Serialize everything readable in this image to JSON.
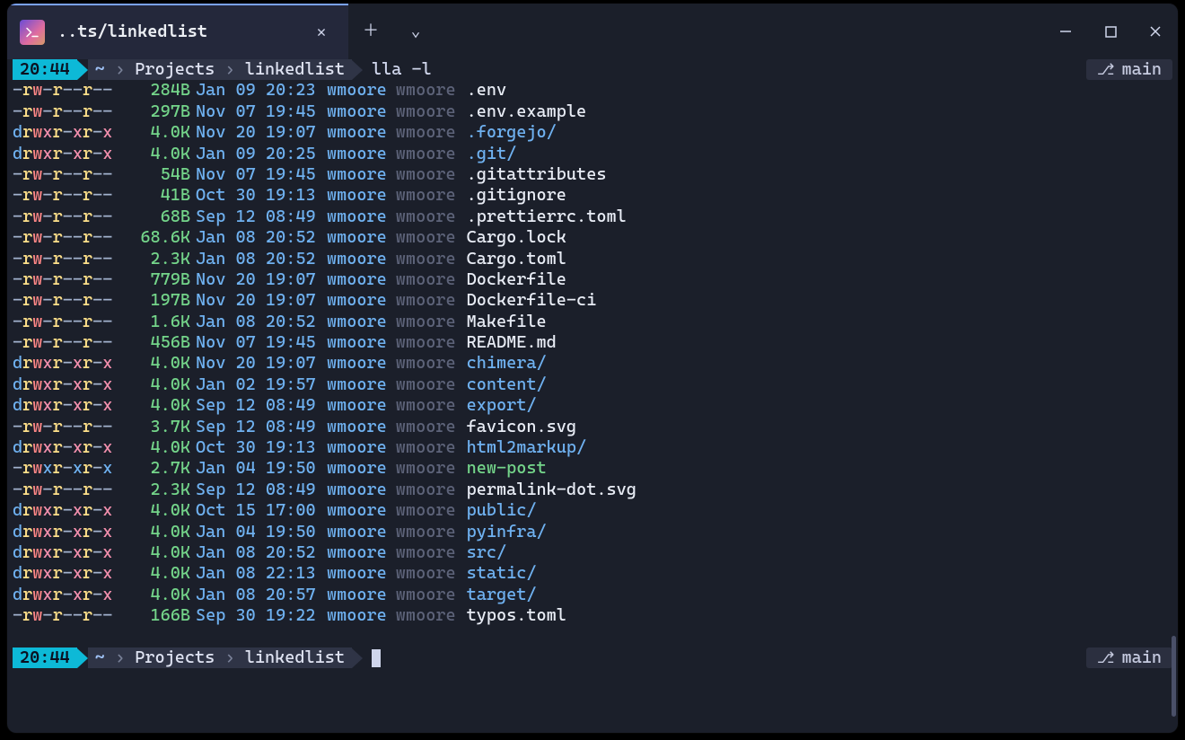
{
  "titlebar": {
    "tab_title": "..ts/linkedlist",
    "close_glyph": "✕",
    "newtab_glyph": "＋",
    "dropdown_glyph": "⌄",
    "min_label": "minimize",
    "max_label": "maximize",
    "close_label": "close"
  },
  "prompt": {
    "time": "20:44",
    "path_segments": [
      "~",
      "Projects",
      "linkedlist"
    ],
    "command": "lla -l",
    "branch": "main"
  },
  "prompt2": {
    "time": "20:44",
    "path_segments": [
      "~",
      "Projects",
      "linkedlist"
    ],
    "branch": "main"
  },
  "files": [
    {
      "perm": "-rw-r--r--",
      "size": "284B",
      "date": "Jan 09 20:23",
      "owner": "wmoore",
      "group": "wmoore",
      "name": ".env",
      "type": "file"
    },
    {
      "perm": "-rw-r--r--",
      "size": "297B",
      "date": "Nov 07 19:45",
      "owner": "wmoore",
      "group": "wmoore",
      "name": ".env.example",
      "type": "file"
    },
    {
      "perm": "drwxr-xr-x",
      "size": "4.0K",
      "date": "Nov 20 19:07",
      "owner": "wmoore",
      "group": "wmoore",
      "name": ".forgejo/",
      "type": "dir"
    },
    {
      "perm": "drwxr-xr-x",
      "size": "4.0K",
      "date": "Jan 09 20:25",
      "owner": "wmoore",
      "group": "wmoore",
      "name": ".git/",
      "type": "dir"
    },
    {
      "perm": "-rw-r--r--",
      "size": "54B",
      "date": "Nov 07 19:45",
      "owner": "wmoore",
      "group": "wmoore",
      "name": ".gitattributes",
      "type": "file"
    },
    {
      "perm": "-rw-r--r--",
      "size": "41B",
      "date": "Oct 30 19:13",
      "owner": "wmoore",
      "group": "wmoore",
      "name": ".gitignore",
      "type": "file"
    },
    {
      "perm": "-rw-r--r--",
      "size": "68B",
      "date": "Sep 12 08:49",
      "owner": "wmoore",
      "group": "wmoore",
      "name": ".prettierrc.toml",
      "type": "file"
    },
    {
      "perm": "-rw-r--r--",
      "size": "68.6K",
      "date": "Jan 08 20:52",
      "owner": "wmoore",
      "group": "wmoore",
      "name": "Cargo.lock",
      "type": "file"
    },
    {
      "perm": "-rw-r--r--",
      "size": "2.3K",
      "date": "Jan 08 20:52",
      "owner": "wmoore",
      "group": "wmoore",
      "name": "Cargo.toml",
      "type": "file"
    },
    {
      "perm": "-rw-r--r--",
      "size": "779B",
      "date": "Nov 20 19:07",
      "owner": "wmoore",
      "group": "wmoore",
      "name": "Dockerfile",
      "type": "file"
    },
    {
      "perm": "-rw-r--r--",
      "size": "197B",
      "date": "Nov 20 19:07",
      "owner": "wmoore",
      "group": "wmoore",
      "name": "Dockerfile-ci",
      "type": "file"
    },
    {
      "perm": "-rw-r--r--",
      "size": "1.6K",
      "date": "Jan 08 20:52",
      "owner": "wmoore",
      "group": "wmoore",
      "name": "Makefile",
      "type": "file"
    },
    {
      "perm": "-rw-r--r--",
      "size": "456B",
      "date": "Nov 07 19:45",
      "owner": "wmoore",
      "group": "wmoore",
      "name": "README.md",
      "type": "file"
    },
    {
      "perm": "drwxr-xr-x",
      "size": "4.0K",
      "date": "Nov 20 19:07",
      "owner": "wmoore",
      "group": "wmoore",
      "name": "chimera/",
      "type": "dir"
    },
    {
      "perm": "drwxr-xr-x",
      "size": "4.0K",
      "date": "Jan 02 19:57",
      "owner": "wmoore",
      "group": "wmoore",
      "name": "content/",
      "type": "dir"
    },
    {
      "perm": "drwxr-xr-x",
      "size": "4.0K",
      "date": "Sep 12 08:49",
      "owner": "wmoore",
      "group": "wmoore",
      "name": "export/",
      "type": "dir"
    },
    {
      "perm": "-rw-r--r--",
      "size": "3.7K",
      "date": "Sep 12 08:49",
      "owner": "wmoore",
      "group": "wmoore",
      "name": "favicon.svg",
      "type": "file"
    },
    {
      "perm": "drwxr-xr-x",
      "size": "4.0K",
      "date": "Oct 30 19:13",
      "owner": "wmoore",
      "group": "wmoore",
      "name": "html2markup/",
      "type": "dir"
    },
    {
      "perm": "-rwxr-xr-x",
      "size": "2.7K",
      "date": "Jan 04 19:50",
      "owner": "wmoore",
      "group": "wmoore",
      "name": "new-post",
      "type": "exe"
    },
    {
      "perm": "-rw-r--r--",
      "size": "2.3K",
      "date": "Sep 12 08:49",
      "owner": "wmoore",
      "group": "wmoore",
      "name": "permalink-dot.svg",
      "type": "file"
    },
    {
      "perm": "drwxr-xr-x",
      "size": "4.0K",
      "date": "Oct 15 17:00",
      "owner": "wmoore",
      "group": "wmoore",
      "name": "public/",
      "type": "dir"
    },
    {
      "perm": "drwxr-xr-x",
      "size": "4.0K",
      "date": "Jan 04 19:50",
      "owner": "wmoore",
      "group": "wmoore",
      "name": "pyinfra/",
      "type": "dir"
    },
    {
      "perm": "drwxr-xr-x",
      "size": "4.0K",
      "date": "Jan 08 20:52",
      "owner": "wmoore",
      "group": "wmoore",
      "name": "src/",
      "type": "dir"
    },
    {
      "perm": "drwxr-xr-x",
      "size": "4.0K",
      "date": "Jan 08 22:13",
      "owner": "wmoore",
      "group": "wmoore",
      "name": "static/",
      "type": "dir"
    },
    {
      "perm": "drwxr-xr-x",
      "size": "4.0K",
      "date": "Jan 08 20:57",
      "owner": "wmoore",
      "group": "wmoore",
      "name": "target/",
      "type": "dir"
    },
    {
      "perm": "-rw-r--r--",
      "size": "166B",
      "date": "Sep 30 19:22",
      "owner": "wmoore",
      "group": "wmoore",
      "name": "typos.toml",
      "type": "file"
    }
  ]
}
